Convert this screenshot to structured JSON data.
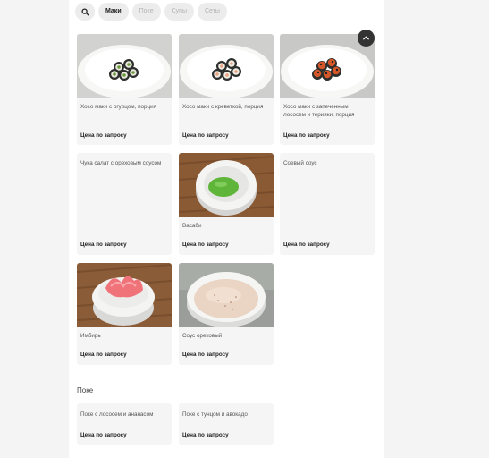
{
  "tabs": [
    {
      "label": ""
    },
    {
      "label": "Маки"
    },
    {
      "label": "Поке"
    },
    {
      "label": "Супы"
    },
    {
      "label": "Сеты"
    }
  ],
  "colors": {
    "accent": "#333333",
    "card_bg": "#f5f5f5",
    "wasabi": "#5fb53a",
    "wood": "#8a5a35"
  },
  "items": [
    {
      "name": "Хосо маки с огурцом, порция",
      "price": "Цена по запросу",
      "image": "cucumber-maki-photo"
    },
    {
      "name": "Хосо маки с креветкой, порция",
      "price": "Цена по запросу",
      "image": "shrimp-maki-photo"
    },
    {
      "name": "Хосо маки с запеченным лососем и терияки, порция",
      "price": "Цена по запросу",
      "image": "salmon-teriyaki-maki-photo"
    },
    {
      "name": "Чука салат с ореховым соусом",
      "price": "Цена по запросу",
      "image": ""
    },
    {
      "name": "Васаби",
      "price": "Цена по запросу",
      "image": "wasabi-photo"
    },
    {
      "name": "Соевый соус",
      "price": "Цена по запросу",
      "image": ""
    },
    {
      "name": "Имбирь",
      "price": "Цена по запросу",
      "image": "ginger-photo"
    },
    {
      "name": "Соус ореховый",
      "price": "Цена по запросу",
      "image": "nut-sauce-photo"
    }
  ],
  "poke_section": {
    "title": "Поке",
    "items": [
      {
        "name": "Поке с лососем и ананасом",
        "price": "Цена по запросу"
      },
      {
        "name": "Поке с тунцом и авокадо",
        "price": "Цена по запросу"
      }
    ]
  }
}
